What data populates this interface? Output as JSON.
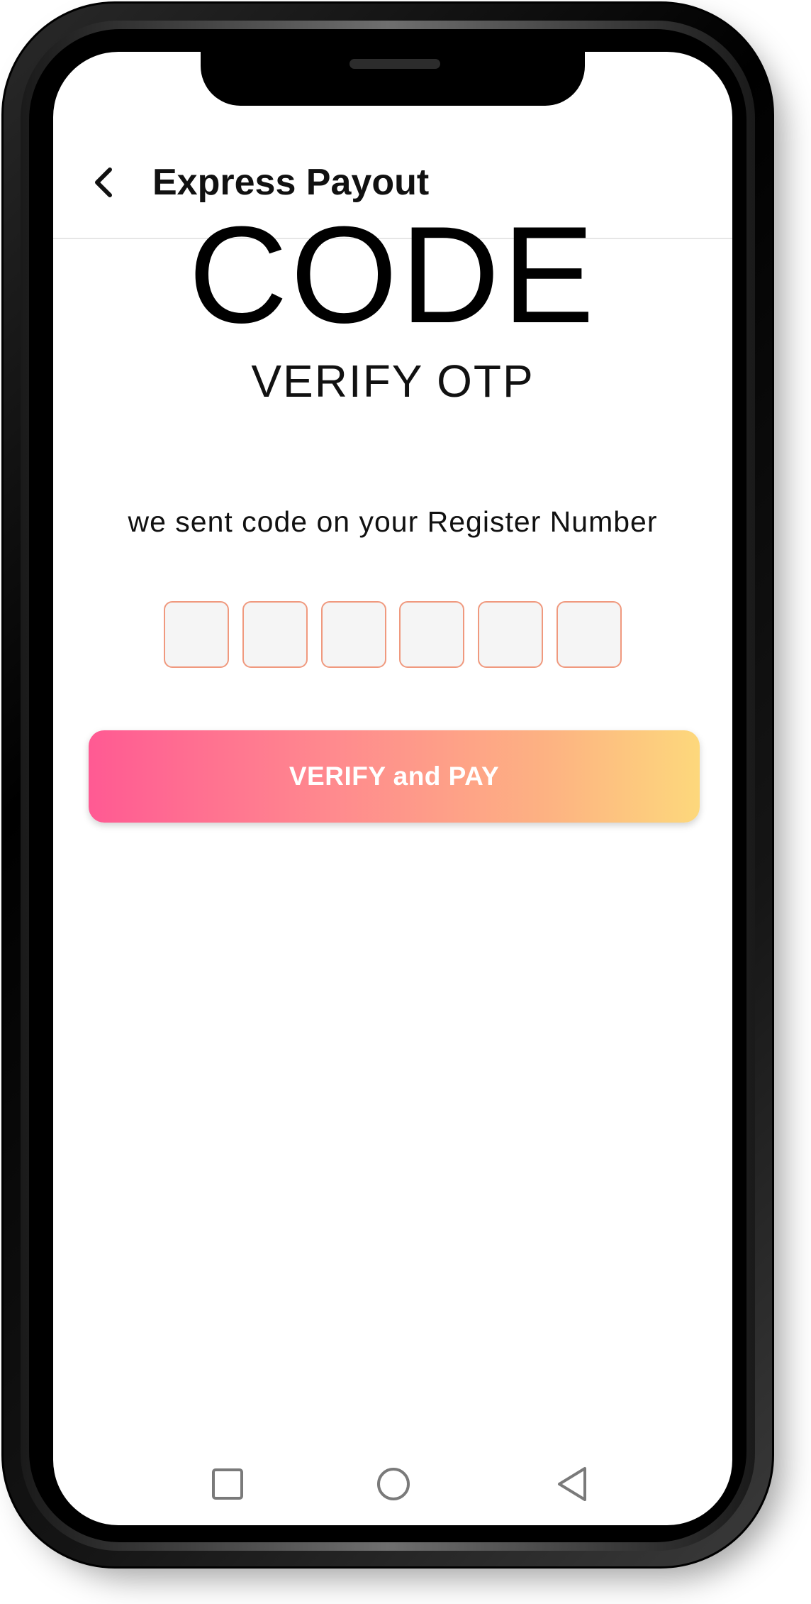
{
  "app_bar": {
    "title": "Express Payout",
    "back_icon": "chevron-left-icon"
  },
  "main": {
    "code_title": "CODE",
    "subtitle": "VERIFY OTP",
    "instruction": "we sent code on your Register Number",
    "otp": {
      "length": 6,
      "values": [
        "",
        "",
        "",
        "",
        "",
        ""
      ]
    },
    "verify_button_label": "VERIFY and PAY"
  },
  "nav_bar": {
    "recents_icon": "square-icon",
    "home_icon": "circle-icon",
    "back_icon": "triangle-back-icon"
  },
  "colors": {
    "otp_border": "#f0997e",
    "otp_fill": "#f5f5f5",
    "button_gradient_start": "#ff5a93",
    "button_gradient_end": "#fdd87c",
    "button_text": "#ffffff"
  }
}
